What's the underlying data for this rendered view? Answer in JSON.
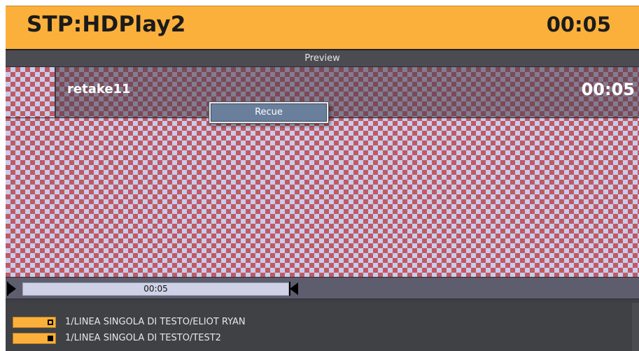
{
  "header": {
    "title": "STP:HDPlay2",
    "timer": "00:05",
    "background": "#fbb03b"
  },
  "preview": {
    "label": "Preview"
  },
  "clip": {
    "name": "retake11",
    "duration": "00:05"
  },
  "context_menu": {
    "items": [
      {
        "label": "Recue"
      }
    ]
  },
  "timeline": {
    "label": "00:05"
  },
  "list": {
    "items": [
      {
        "label": "1/LINEA SINGOLA DI TESTO/ELIOT RYAN",
        "state": "off"
      },
      {
        "label": "1/LINEA SINGOLA DI TESTO/TEST2",
        "state": "on"
      }
    ]
  }
}
